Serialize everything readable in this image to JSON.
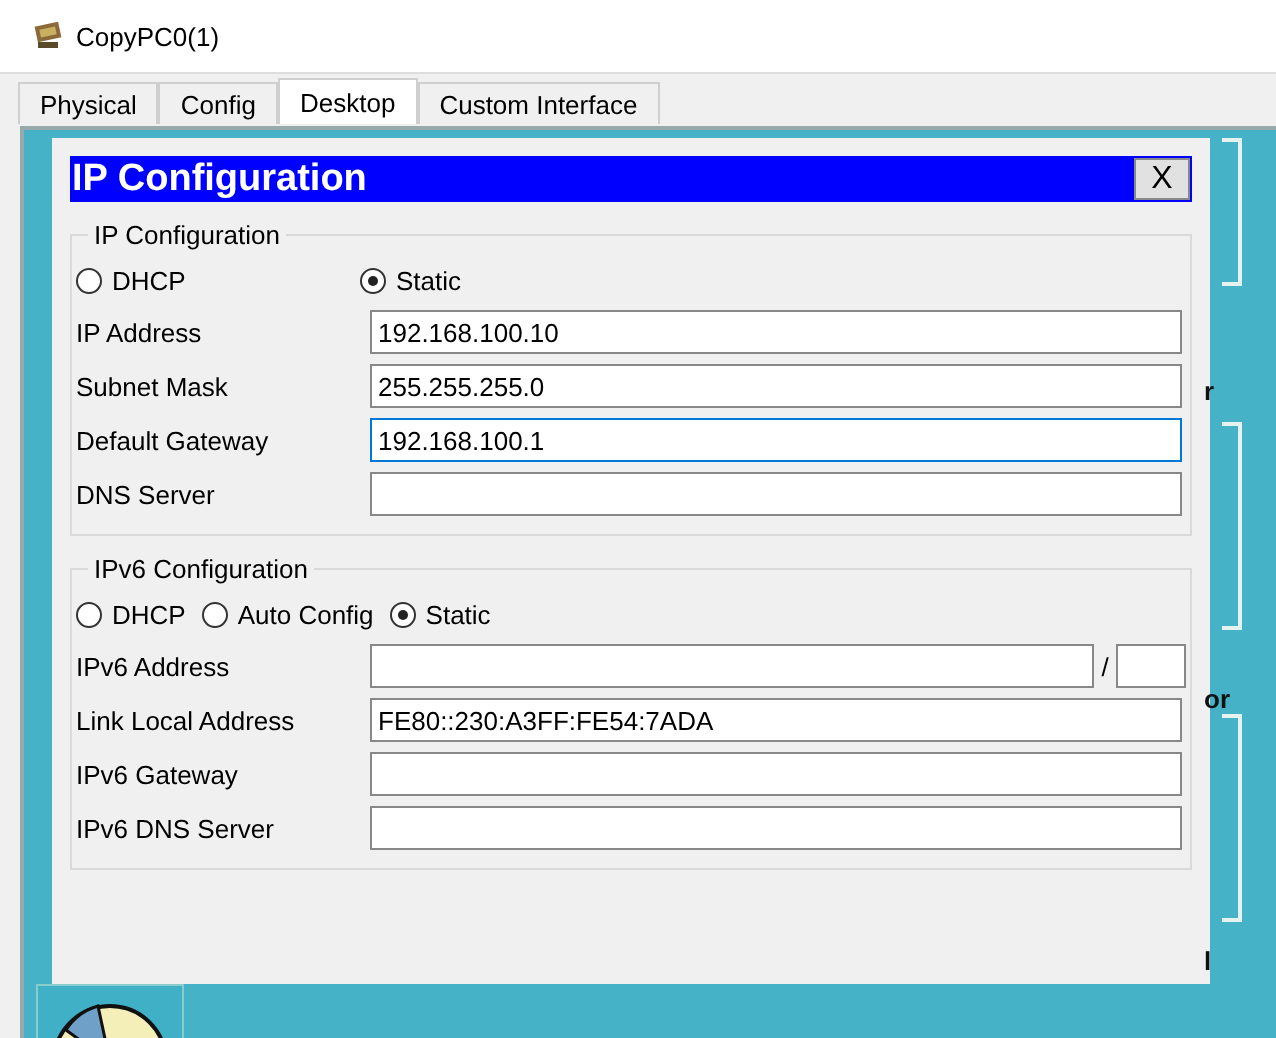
{
  "window": {
    "title": "CopyPC0(1)"
  },
  "tabs": [
    {
      "label": "Physical",
      "selected": false
    },
    {
      "label": "Config",
      "selected": false
    },
    {
      "label": "Desktop",
      "selected": true
    },
    {
      "label": "Custom Interface",
      "selected": false
    }
  ],
  "desktop_fragments": [
    "r",
    "or",
    "l"
  ],
  "dialog": {
    "title": "IP Configuration",
    "close": "X",
    "ipv4": {
      "legend": "IP Configuration",
      "modes": [
        {
          "label": "DHCP",
          "selected": false
        },
        {
          "label": "Static",
          "selected": true
        }
      ],
      "fields": [
        {
          "label": "IP Address",
          "value": "192.168.100.10",
          "focused": false
        },
        {
          "label": "Subnet Mask",
          "value": "255.255.255.0",
          "focused": false
        },
        {
          "label": "Default Gateway",
          "value": "192.168.100.1",
          "focused": true
        },
        {
          "label": "DNS Server",
          "focused": false
        }
      ]
    },
    "ipv6": {
      "legend": "IPv6 Configuration",
      "prefix_separator": "/",
      "modes": [
        {
          "label": "DHCP",
          "selected": false
        },
        {
          "label": "Auto Config",
          "selected": false
        },
        {
          "label": "Static",
          "selected": true
        }
      ],
      "fields": [
        {
          "label": "IPv6 Address",
          "kind": "prefixed",
          "focused": false
        },
        {
          "label": "Link Local Address",
          "value": "FE80::230:A3FF:FE54:7ADA",
          "kind": "plain",
          "focused": false
        },
        {
          "label": "IPv6 Gateway",
          "kind": "plain",
          "focused": false
        },
        {
          "label": "IPv6 DNS Server",
          "kind": "plain",
          "focused": false
        }
      ]
    }
  }
}
